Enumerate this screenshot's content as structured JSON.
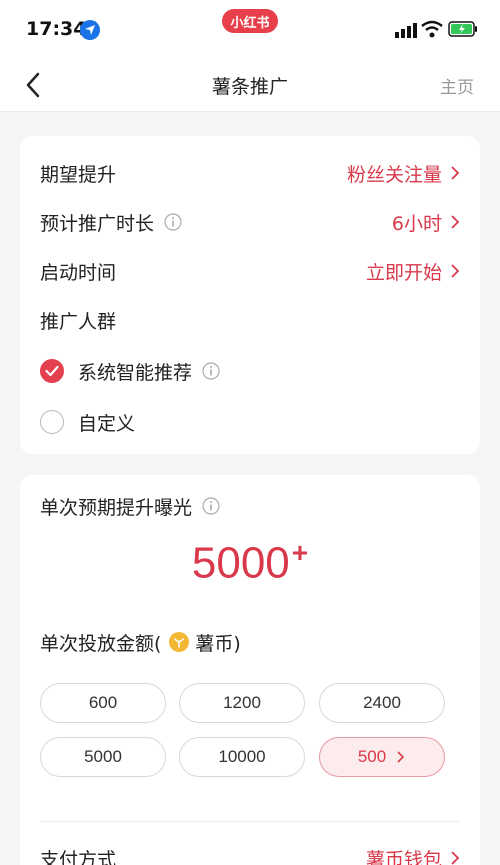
{
  "status": {
    "time": "17:34",
    "app_name": "小红书"
  },
  "nav": {
    "title": "薯条推广",
    "home_label": "主页"
  },
  "settings": {
    "goal": {
      "label": "期望提升",
      "value": "粉丝关注量"
    },
    "duration": {
      "label": "预计推广时长",
      "value": "6小时"
    },
    "start": {
      "label": "启动时间",
      "value": "立即开始"
    },
    "audience": {
      "label": "推广人群",
      "options": [
        {
          "label": "系统智能推荐",
          "selected": true
        },
        {
          "label": "自定义",
          "selected": false
        }
      ]
    }
  },
  "exposure": {
    "label": "单次预期提升曝光",
    "value": "5000",
    "suffix": "+"
  },
  "amount": {
    "label_prefix": "单次投放金额(",
    "currency": "薯币)",
    "options": [
      "600",
      "1200",
      "2400",
      "5000",
      "10000",
      "500"
    ],
    "selected_index": 5
  },
  "payment": {
    "label": "支付方式",
    "value": "薯币钱包"
  },
  "colors": {
    "accent": "#d9394a",
    "brand": "#e8404a"
  }
}
